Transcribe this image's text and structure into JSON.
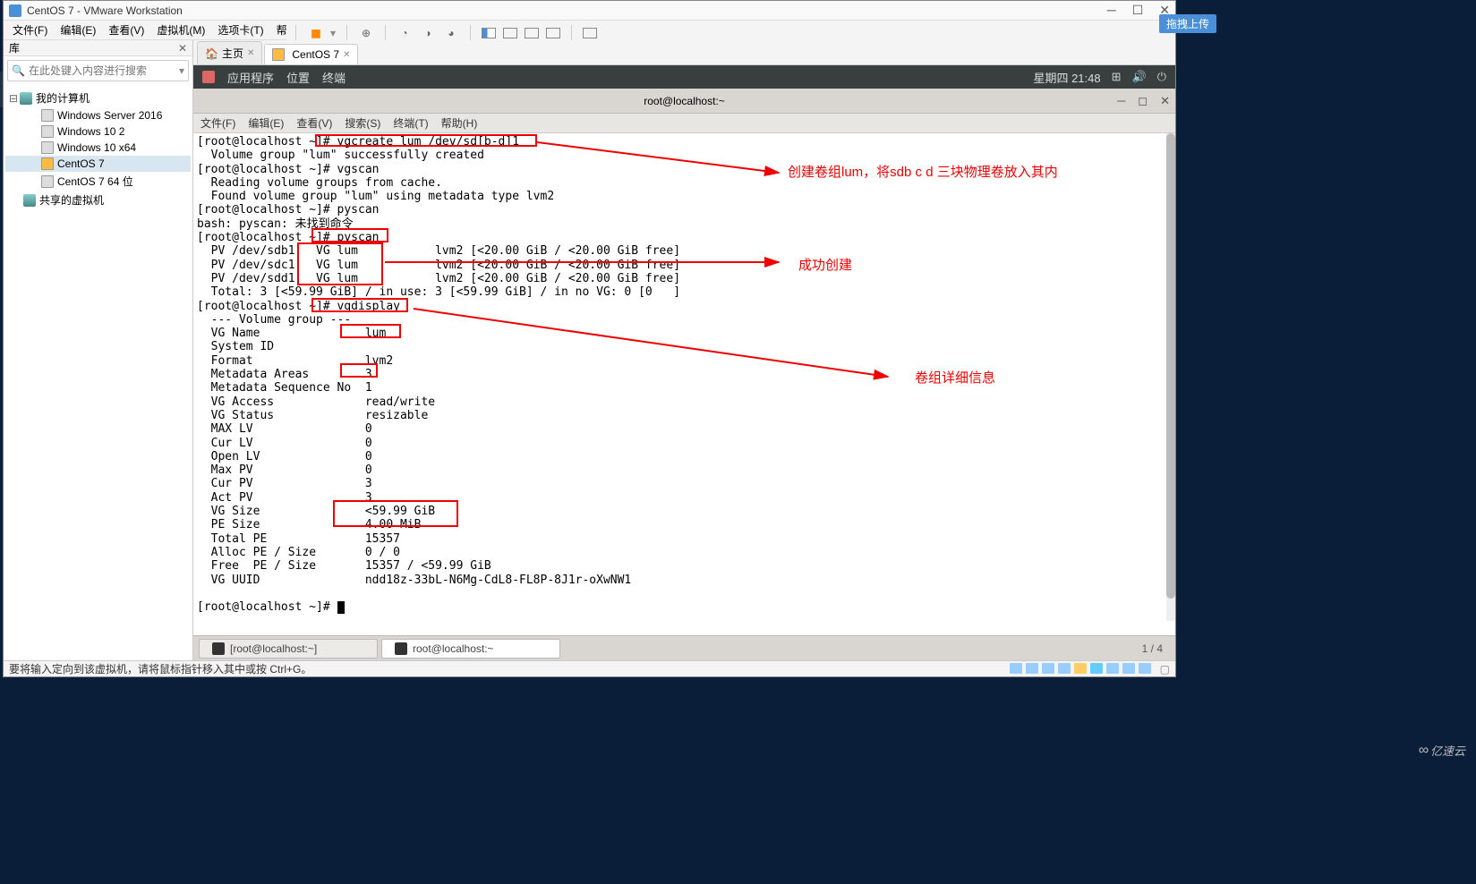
{
  "window": {
    "title": "CentOS 7 - VMware Workstation"
  },
  "menubar": {
    "file": "文件(F)",
    "edit": "编辑(E)",
    "view": "查看(V)",
    "vm": "虚拟机(M)",
    "tabs": "选项卡(T)",
    "help": "帮助(H)"
  },
  "sidebar": {
    "title": "库",
    "search_placeholder": "在此处键入内容进行搜索",
    "root": "我的计算机",
    "items": [
      "Windows Server 2016",
      "Windows 10 2",
      "Windows 10 x64",
      "CentOS 7",
      "CentOS 7 64 位"
    ],
    "shared": "共享的虚拟机"
  },
  "tabs": {
    "home": "主页",
    "centos": "CentOS 7"
  },
  "gnome": {
    "apps": "应用程序",
    "places": "位置",
    "terminal": "终端",
    "clock": "星期四 21:48"
  },
  "terminal": {
    "title": "root@localhost:~",
    "menu": {
      "file": "文件(F)",
      "edit": "编辑(E)",
      "view": "查看(V)",
      "search": "搜索(S)",
      "terminal": "终端(T)",
      "help": "帮助(H)"
    },
    "content": "[root@localhost ~]# vgcreate lum /dev/sd[b-d]1\n  Volume group \"lum\" successfully created\n[root@localhost ~]# vgscan\n  Reading volume groups from cache.\n  Found volume group \"lum\" using metadata type lvm2\n[root@localhost ~]# pyscan\nbash: pyscan: 未找到命令\n[root@localhost ~]# pvscan\n  PV /dev/sdb1   VG lum           lvm2 [<20.00 GiB / <20.00 GiB free]\n  PV /dev/sdc1   VG lum           lvm2 [<20.00 GiB / <20.00 GiB free]\n  PV /dev/sdd1   VG lum           lvm2 [<20.00 GiB / <20.00 GiB free]\n  Total: 3 [<59.99 GiB] / in use: 3 [<59.99 GiB] / in no VG: 0 [0   ]\n[root@localhost ~]# vgdisplay\n  --- Volume group ---\n  VG Name               lum\n  System ID             \n  Format                lvm2\n  Metadata Areas        3\n  Metadata Sequence No  1\n  VG Access             read/write\n  VG Status             resizable\n  MAX LV                0\n  Cur LV                0\n  Open LV               0\n  Max PV                0\n  Cur PV                3\n  Act PV                3\n  VG Size               <59.99 GiB\n  PE Size               4.00 MiB\n  Total PE              15357\n  Alloc PE / Size       0 / 0   \n  Free  PE / Size       15357 / <59.99 GiB\n  VG UUID               ndd18z-33bL-N6Mg-CdL8-FL8P-8J1r-oXwNW1\n   \n[root@localhost ~]# "
  },
  "annotations": {
    "a1": "创建卷组lum，将sdb c d 三块物理卷放入其内",
    "a2": "成功创建",
    "a3": "卷组详细信息"
  },
  "taskbar": {
    "item1": "[root@localhost:~]",
    "item2": "root@localhost:~",
    "counter": "1 / 4"
  },
  "statusbar": {
    "hint": "要将输入定向到该虚拟机，请将鼠标指针移入其中或按 Ctrl+G。"
  },
  "badges": {
    "upload": "拖拽上传",
    "watermark": "亿速云"
  }
}
